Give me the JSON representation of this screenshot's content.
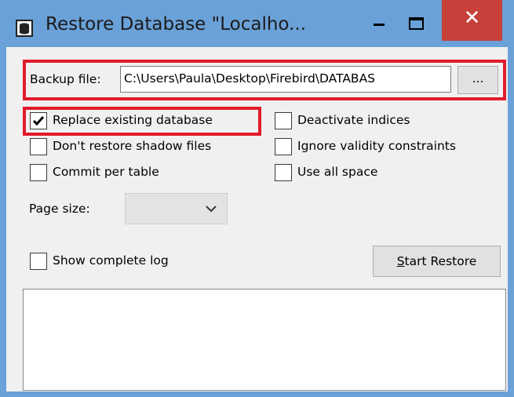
{
  "window": {
    "title": "Restore Database \"Localho...",
    "title_icon": "database-icon"
  },
  "titlebar": {
    "minimize_label": "–",
    "maximize_label": "☐",
    "close_label": "✕"
  },
  "backup": {
    "label": "Backup file:",
    "value": "C:\\Users\\Paula\\Desktop\\Firebird\\DATABAS",
    "browse_label": "..."
  },
  "options": {
    "replace_existing": {
      "label": "Replace existing database",
      "checked": true
    },
    "deactivate_indices": {
      "label": "Deactivate indices",
      "checked": false
    },
    "dont_restore_shadow": {
      "label": "Don't restore shadow files",
      "checked": false
    },
    "ignore_validity": {
      "label": "Ignore validity constraints",
      "checked": false
    },
    "commit_per_table": {
      "label": "Commit per table",
      "checked": false
    },
    "use_all_space": {
      "label": "Use all space",
      "checked": false
    }
  },
  "page_size": {
    "label": "Page size:",
    "value": ""
  },
  "show_log": {
    "label": "Show complete log",
    "checked": false
  },
  "start_button": {
    "label": "Start Restore",
    "accelerator": "S",
    "rest": "tart Restore"
  },
  "log": {
    "text": ""
  },
  "colors": {
    "titlebar": "#6aa1d8",
    "close_button": "#c7403a",
    "highlight": "#e11b2b",
    "client": "#f0f0f0"
  }
}
